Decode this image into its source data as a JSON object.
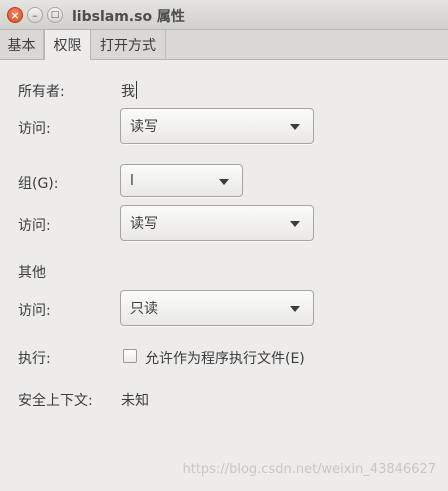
{
  "window": {
    "title": "libslam.so 属性",
    "close_glyph": "×",
    "minimize_glyph": "–",
    "maximize_glyph": "□"
  },
  "tabs": [
    {
      "label": "基本",
      "active": false
    },
    {
      "label": "权限",
      "active": true
    },
    {
      "label": "打开方式",
      "active": false
    }
  ],
  "permissions": {
    "owner_label": "所有者:",
    "owner_value": "我",
    "owner_access_label": "访问:",
    "owner_access_value": "读写",
    "group_label": "组(G):",
    "group_value": "l",
    "group_access_label": "访问:",
    "group_access_value": "读写",
    "others_label": "其他",
    "others_access_label": "访问:",
    "others_access_value": "只读",
    "execute_label": "执行:",
    "execute_checkbox_label": "允许作为程序执行文件(E)",
    "execute_checked": false,
    "security_context_label": "安全上下文:",
    "security_context_value": "未知"
  },
  "watermark": "https://blog.csdn.net/weixin_43846627"
}
